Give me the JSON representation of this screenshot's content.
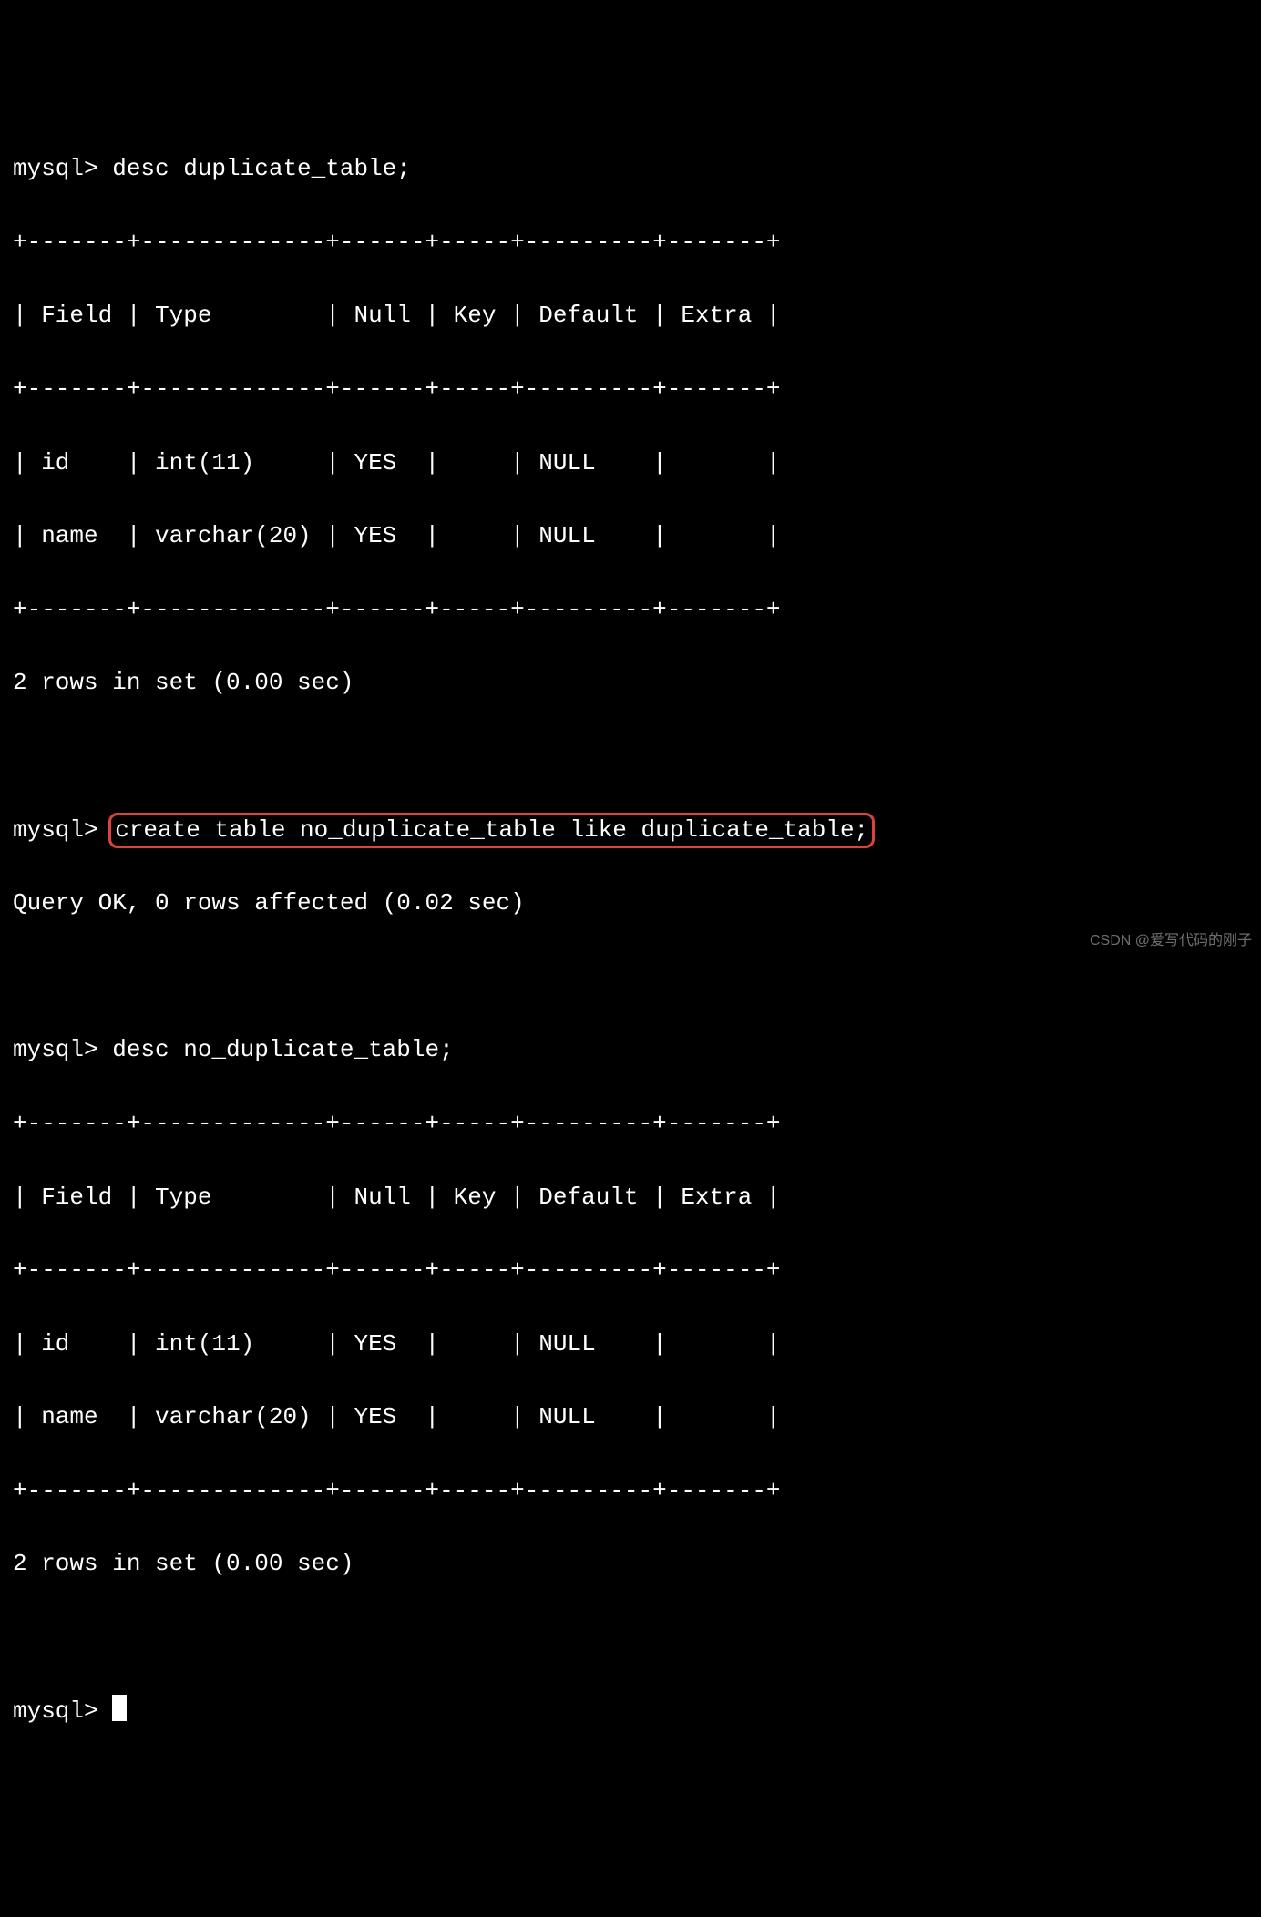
{
  "prompt": "mysql> ",
  "commands": {
    "desc_dup": "desc duplicate_table;",
    "create": "create table no_duplicate_table like duplicate_table;",
    "create_result": "Query OK, 0 rows affected (0.02 sec)",
    "desc_nodup": "desc no_duplicate_table;",
    "rows_summary": "2 rows in set (0.00 sec)"
  },
  "table": {
    "border": "+-------+-------------+------+-----+---------+-------+",
    "header": "| Field | Type        | Null | Key | Default | Extra |",
    "row_id": "| id    | int(11)     | YES  |     | NULL    |       |",
    "row_name": "| name  | varchar(20) | YES  |     | NULL    |       |"
  },
  "watermark": "CSDN @爱写代码的刚子"
}
